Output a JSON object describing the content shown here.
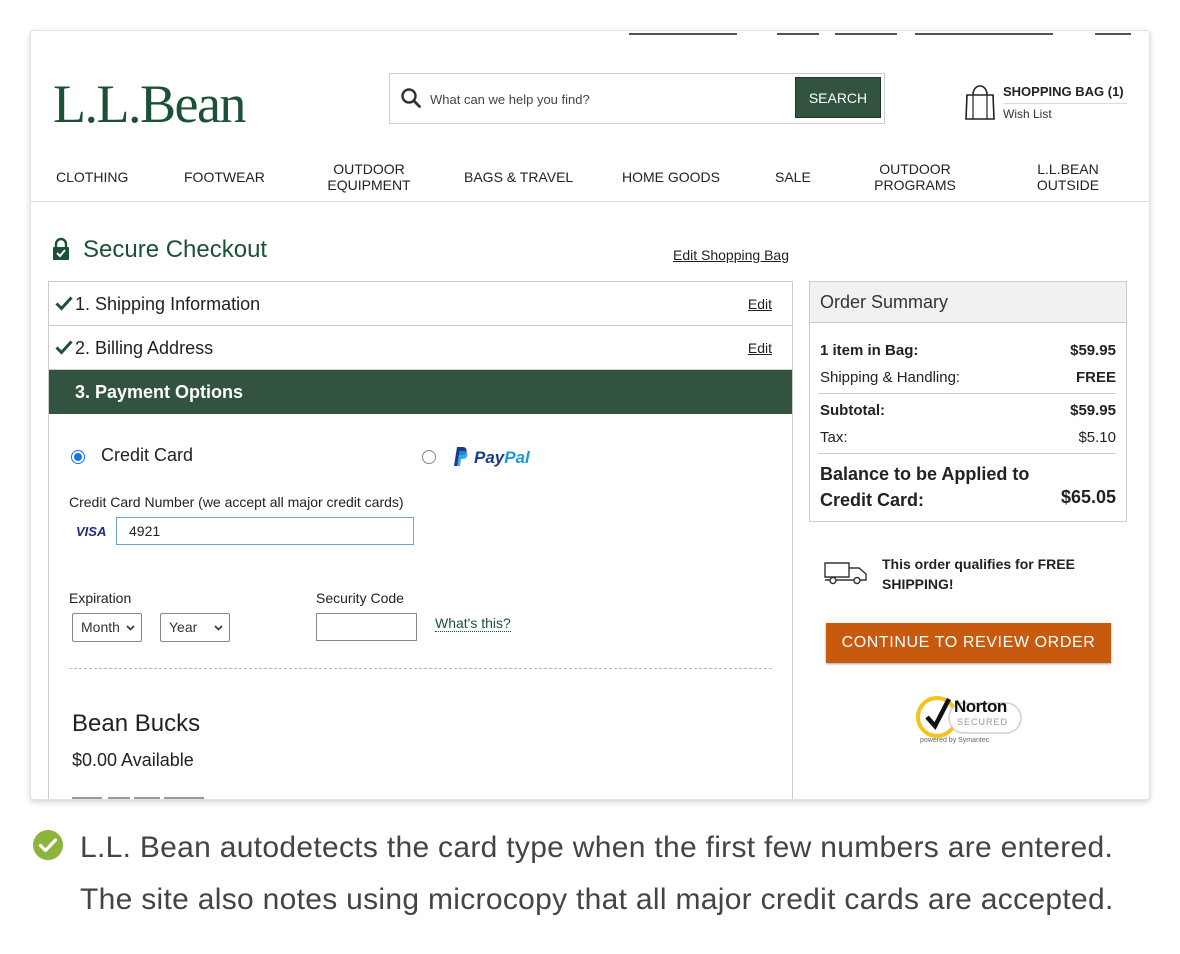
{
  "header": {
    "logo_text": "L.L.Bean",
    "search_placeholder": "What can we help you find?",
    "search_button": "SEARCH",
    "bag_label": "SHOPPING BAG (1)",
    "wish_list": "Wish List"
  },
  "nav": {
    "items": [
      {
        "label": "CLOTHING"
      },
      {
        "label": "FOOTWEAR"
      },
      {
        "label": "OUTDOOR EQUIPMENT",
        "line1": "OUTDOOR",
        "line2": "EQUIPMENT"
      },
      {
        "label": "BAGS & TRAVEL"
      },
      {
        "label": "HOME GOODS"
      },
      {
        "label": "SALE"
      },
      {
        "label": "OUTDOOR PROGRAMS",
        "line1": "OUTDOOR",
        "line2": "PROGRAMS"
      },
      {
        "label": "L.L.BEAN OUTSIDE",
        "line1": "L.L.BEAN",
        "line2": "OUTSIDE"
      }
    ]
  },
  "checkout": {
    "title": "Secure Checkout",
    "edit_bag": "Edit Shopping Bag",
    "steps": [
      {
        "label": "1. Shipping Information",
        "edit": "Edit",
        "done": true
      },
      {
        "label": "2. Billing Address",
        "edit": "Edit",
        "done": true
      },
      {
        "label": "3. Payment Options",
        "active": true
      }
    ]
  },
  "payment": {
    "credit_card_label": "Credit Card",
    "credit_card_selected": true,
    "paypal_label_a": "Pay",
    "paypal_label_b": "Pal",
    "card_number_label": "Credit Card Number (we accept all major credit cards)",
    "card_type": "VISA",
    "card_number_value": "4921",
    "expiration_label": "Expiration",
    "month_selected": "Month",
    "year_selected": "Year",
    "security_label": "Security Code",
    "whats_this": "What's this?"
  },
  "bean_bucks": {
    "title": "Bean Bucks",
    "available": "$0.00 Available"
  },
  "summary": {
    "title": "Order Summary",
    "items_label": "1 item in Bag:",
    "items_value": "$59.95",
    "shipping_label": "Shipping & Handling:",
    "shipping_value": "FREE",
    "subtotal_label": "Subtotal:",
    "subtotal_value": "$59.95",
    "tax_label": "Tax:",
    "tax_value": "$5.10",
    "balance_label_1": "Balance to be Applied to",
    "balance_label_2": "Credit Card:",
    "balance_value": "$65.05"
  },
  "free_shipping": "This order qualifies for FREE SHIPPING!",
  "continue_button": "CONTINUE TO REVIEW ORDER",
  "norton": {
    "brand": "Norton",
    "secured": "SECURED",
    "powered": "powered by Symantec"
  },
  "caption": "L.L. Bean autodetects the card type when the first few numbers are entered. The site also notes using microcopy that all major credit cards are accepted.",
  "colors": {
    "brand_green": "#1d5135",
    "header_green": "#325340",
    "cta_orange": "#c75a0f",
    "check_green": "#8ab43c"
  }
}
